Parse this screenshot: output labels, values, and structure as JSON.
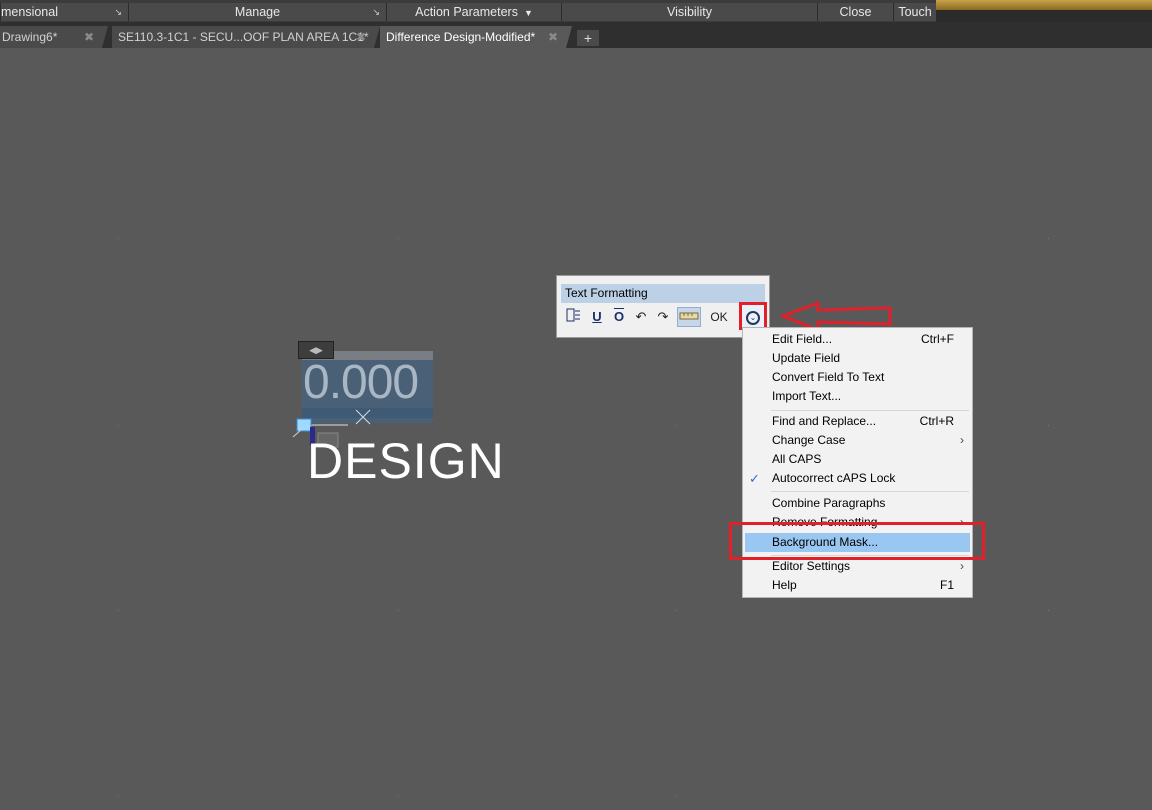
{
  "ribbon": {
    "panels": [
      "mensional",
      "Manage",
      "Action Parameters",
      "Visibility",
      "Close",
      "Touch"
    ]
  },
  "tabs": {
    "items": [
      "Drawing6*",
      "SE110.3-1C1 - SECU...OOF PLAN AREA 1C1*",
      "Difference Design-Modified*"
    ],
    "active": "Difference Design-Modified*",
    "add_label": "+"
  },
  "canvas": {
    "field_value": "0.000",
    "text": "DESIGN"
  },
  "text_formatting": {
    "title": "Text Formatting",
    "ok_label": "OK"
  },
  "context_menu": {
    "items": [
      {
        "label": "Edit Field...",
        "shortcut": "Ctrl+F"
      },
      {
        "label": "Update Field",
        "shortcut": ""
      },
      {
        "label": "Convert Field To Text",
        "shortcut": ""
      },
      {
        "label": "Import Text...",
        "shortcut": ""
      },
      {
        "label": "Find and Replace...",
        "shortcut": "Ctrl+R"
      },
      {
        "label": "Change Case",
        "shortcut": "",
        "submenu": true
      },
      {
        "label": "All CAPS",
        "shortcut": ""
      },
      {
        "label": "Autocorrect cAPS Lock",
        "shortcut": "",
        "checked": true
      },
      {
        "label": "Combine Paragraphs",
        "shortcut": ""
      },
      {
        "label": "Remove Formatting",
        "shortcut": "",
        "submenu": true
      },
      {
        "label": "Background Mask...",
        "shortcut": "",
        "highlighted": true
      },
      {
        "label": "Editor Settings",
        "shortcut": "",
        "submenu": true
      },
      {
        "label": "Help",
        "shortcut": "F1"
      }
    ]
  },
  "colors": {
    "canvas": "#595959",
    "annotation_red": "#e1202a",
    "menu_highlight": "#99c7f2"
  }
}
